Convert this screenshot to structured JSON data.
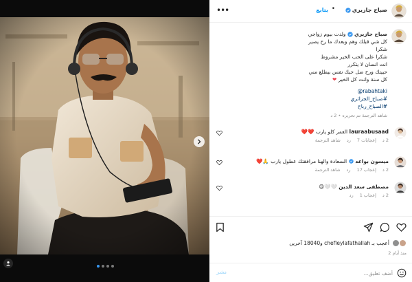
{
  "post": {
    "author": "صباح جازيري",
    "follow_label": "يتابع",
    "separator": "•",
    "more_label": "•••"
  },
  "caption": {
    "username": "صباح جازيري",
    "lines": [
      "ولدت بيوم زواجي",
      "كل شي قبلك وهم وبعدك ما رح يصير",
      "شكرا",
      "شكرا على الحب الخير مشروط",
      "انت انسان لا يتكرر",
      "حبيتك ورح ضل حبك نفس بيطلع مني",
      "كل سنة وانت كل الخير"
    ],
    "mention": "@rabahtaki",
    "hashtags": [
      "#صباح_الجزائري",
      "#الصباح_رباح"
    ],
    "meta": "شاهد الترجمة تم تحريره • 2 د"
  },
  "comments": [
    {
      "username": "lauraabusaad",
      "text": "العمر كلو يارب ❤️❤️",
      "age": "2 د",
      "likes": "إعجابات 7",
      "reply": "رد",
      "translate": "شاهد الترجمة"
    },
    {
      "username": "ميسون بواعد",
      "text": "السعادة والهنا مرافقتك عطول يارب 🙏❤️",
      "age": "2 د",
      "likes": "إعجاب 17",
      "reply": "رد",
      "translate": "شاهد الترجمة"
    },
    {
      "username": "مصطفى سعد الدين",
      "text": "🤍🤍😍",
      "age": "2 د",
      "likes": "إعجاب 1",
      "reply": "رد",
      "translate": ""
    }
  ],
  "likes": {
    "text": "أعجب بـ chefleylafathallah و18040 آخرين"
  },
  "time_ago": "منذ أيام 2",
  "add_comment": {
    "placeholder": "أضف تعليق...",
    "post_label": "نشر"
  },
  "carousel": {
    "slides": 4,
    "active_slide": 1
  },
  "colors": {
    "accent": "#0095f6",
    "verified": "#3897f0",
    "heart_red": "#ed4956"
  },
  "icons": [
    "more-icon",
    "verified-icon",
    "heart-icon",
    "comment-icon",
    "share-icon",
    "save-icon",
    "emoji-icon",
    "chevron-right-icon",
    "tag-users-icon"
  ]
}
